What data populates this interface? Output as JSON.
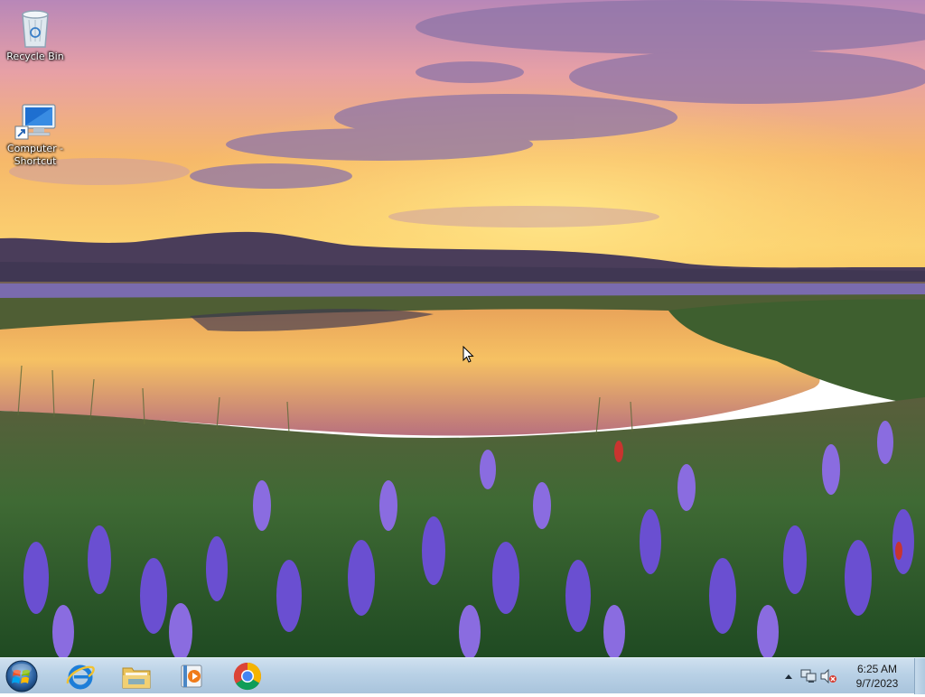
{
  "desktop": {
    "icons": [
      {
        "label": "Recycle Bin",
        "icon": "recycle-bin-icon"
      },
      {
        "label": "Computer -\nShortcut",
        "icon": "computer-shortcut-icon"
      }
    ],
    "wallpaper": "sunset-lake-wildflowers"
  },
  "taskbar": {
    "start_icon": "windows-start-orb-icon",
    "pinned": [
      {
        "icon": "internet-explorer-icon"
      },
      {
        "icon": "file-explorer-icon"
      },
      {
        "icon": "media-player-icon"
      },
      {
        "icon": "google-chrome-icon"
      }
    ],
    "tray": {
      "icons": [
        "show-hidden-icons-icon",
        "network-icon",
        "volume-muted-icon"
      ],
      "time": "6:25 AM",
      "date": "9/7/2023"
    }
  },
  "colors": {
    "taskbar": "#b9d1e6",
    "sky_top": "#c98fb6",
    "sunset": "#f7c04a",
    "flowers": "#6a4fd1"
  }
}
